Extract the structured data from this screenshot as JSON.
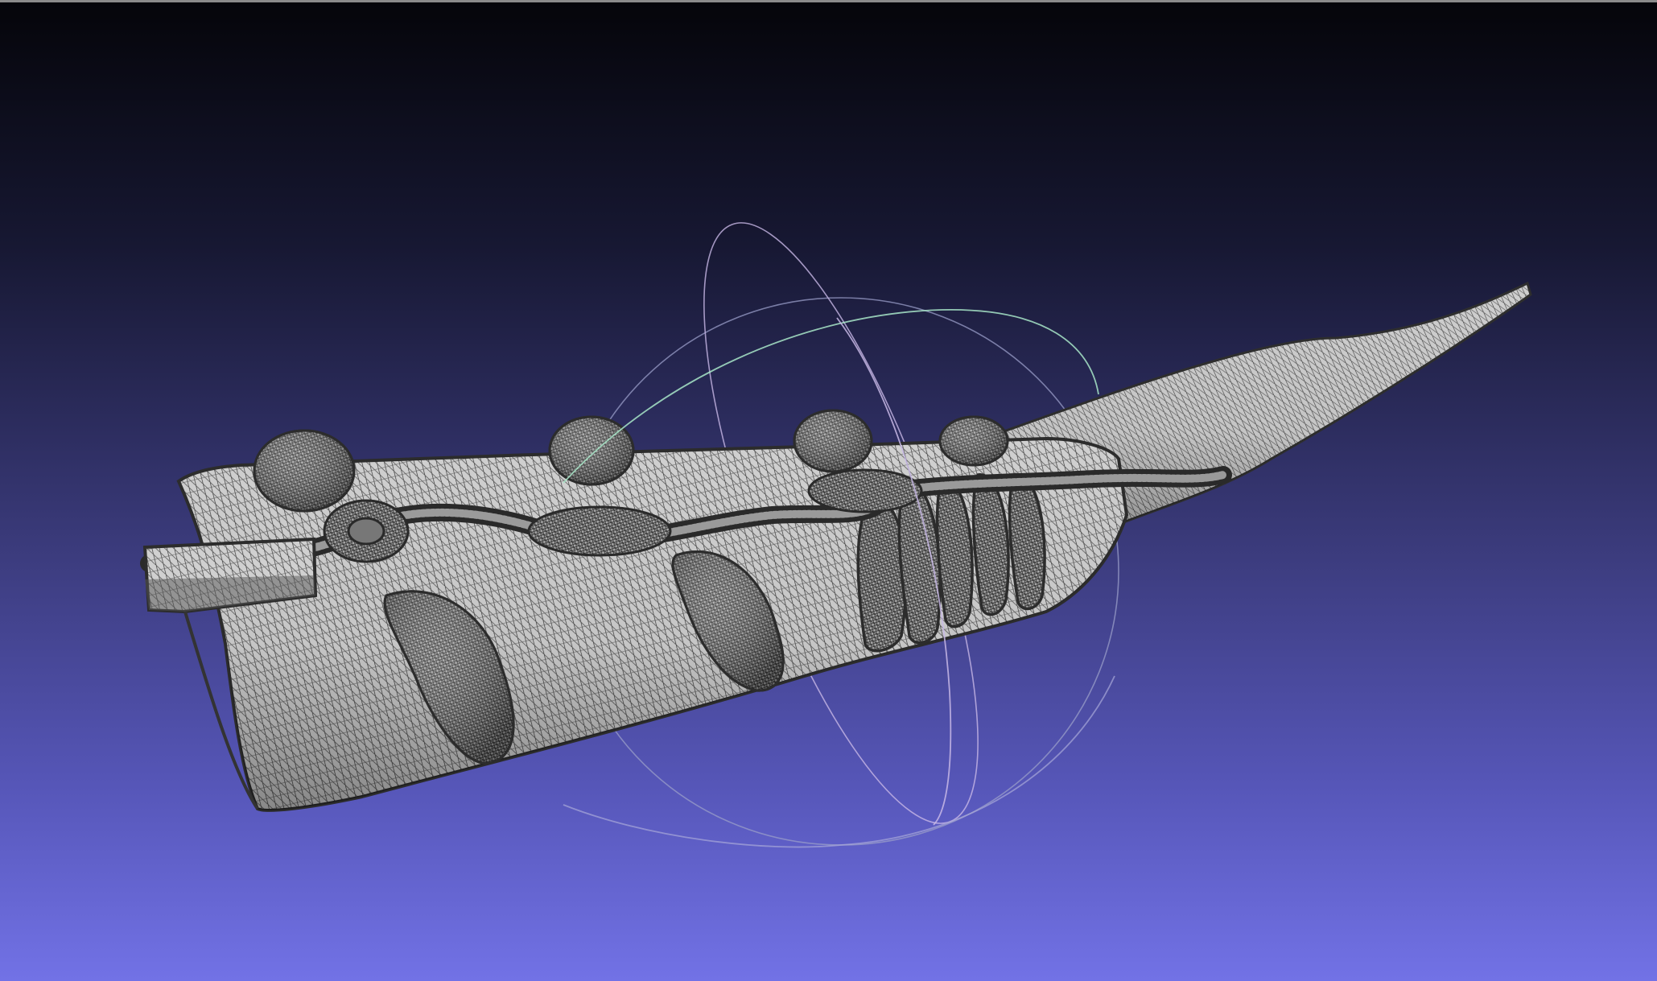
{
  "viewer": {
    "background_top_color": "#05050a",
    "background_bottom_color": "#7272e6",
    "mesh_fill_color": "#c8c8c8",
    "mesh_wire_color": "#3c3c3c",
    "trackball_colors": {
      "ring_horizontal": "#9aa0c8",
      "ring_vertical": "#c0b0e0",
      "ring_tilted": "#a0e0c0"
    },
    "model": "curved-horn-wireframe-mesh",
    "render_mode": "wireframe-over-shaded"
  }
}
